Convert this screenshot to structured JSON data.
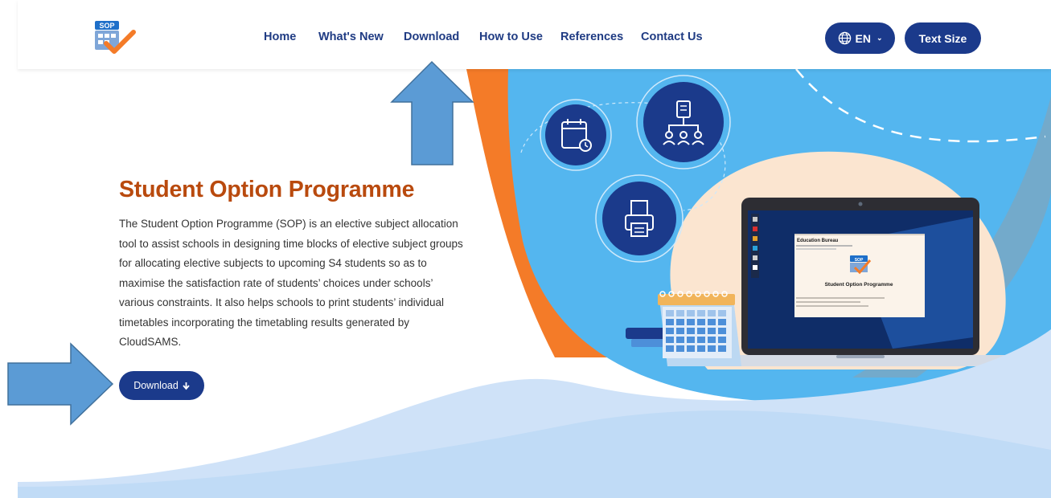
{
  "header": {
    "logo_text": "SOP",
    "nav": [
      {
        "label": "Home"
      },
      {
        "label": "What's New"
      },
      {
        "label": "Download"
      },
      {
        "label": "How to Use"
      },
      {
        "label": "References"
      },
      {
        "label": "Contact Us"
      }
    ],
    "lang_label": "EN",
    "text_size_label": "Text Size"
  },
  "hero": {
    "title": "Student Option Programme",
    "description": "The Student Option Programme (SOP) is an elective subject allocation tool to assist schools in designing time blocks of elective subject groups for allocating elective subjects to upcoming S4 students so as to maximise the satisfaction rate of students’ choices under schools’ various constraints. It also helps schools to print students’ individual timetables incorporating the timetabling results generated by CloudSAMS.",
    "download_label": "Download"
  },
  "laptop_screen": {
    "heading": "Education Bureau",
    "logo_text": "SOP",
    "app_title": "Student Option Programme"
  },
  "colors": {
    "nav_text": "#1f3b83",
    "button_bg": "#1b3a8b",
    "title": "#b94a0e",
    "sky_blue": "#54b6ef",
    "orange": "#f47b28",
    "arrow_fill": "#5b9bd5",
    "arrow_stroke": "#41719c"
  }
}
